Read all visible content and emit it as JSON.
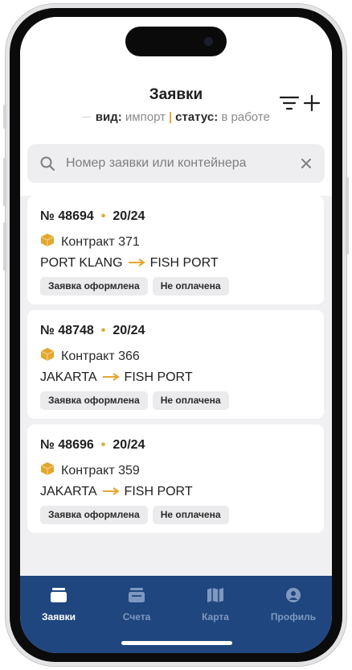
{
  "header": {
    "title": "Заявки",
    "filter": {
      "type_key": "вид:",
      "type_value": "импорт",
      "separator": "|",
      "status_key": "статус:",
      "status_value": "в работе"
    },
    "filter_icon": "filter-icon",
    "add_icon": "plus-icon"
  },
  "search": {
    "placeholder": "Номер заявки или контейнера",
    "value": "",
    "icon": "search-icon",
    "clear_icon": "close-icon"
  },
  "orders": [
    {
      "number": "№ 48694",
      "week": "20/24",
      "contract": "Контракт 371",
      "from": "PORT KLANG",
      "to": "FISH PORT",
      "status": "Заявка оформлена",
      "payment": "Не оплачена"
    },
    {
      "number": "№ 48748",
      "week": "20/24",
      "contract": "Контракт 366",
      "from": "JAKARTA",
      "to": "FISH PORT",
      "status": "Заявка оформлена",
      "payment": "Не оплачена"
    },
    {
      "number": "№ 48696",
      "week": "20/24",
      "contract": "Контракт 359",
      "from": "JAKARTA",
      "to": "FISH PORT",
      "status": "Заявка оформлена",
      "payment": "Не оплачена"
    }
  ],
  "tabbar": {
    "items": [
      {
        "label": "Заявки",
        "icon": "orders-icon",
        "active": true
      },
      {
        "label": "Счета",
        "icon": "invoices-icon",
        "active": false
      },
      {
        "label": "Карта",
        "icon": "map-icon",
        "active": false
      },
      {
        "label": "Профиль",
        "icon": "profile-icon",
        "active": false
      }
    ]
  },
  "colors": {
    "accent": "#e3a730",
    "tabbar_bg": "#1f467f",
    "tab_inactive": "#7f98c0",
    "card_bg": "#ffffff",
    "list_bg": "#f0f0f2",
    "badge_bg": "#ebebed"
  }
}
